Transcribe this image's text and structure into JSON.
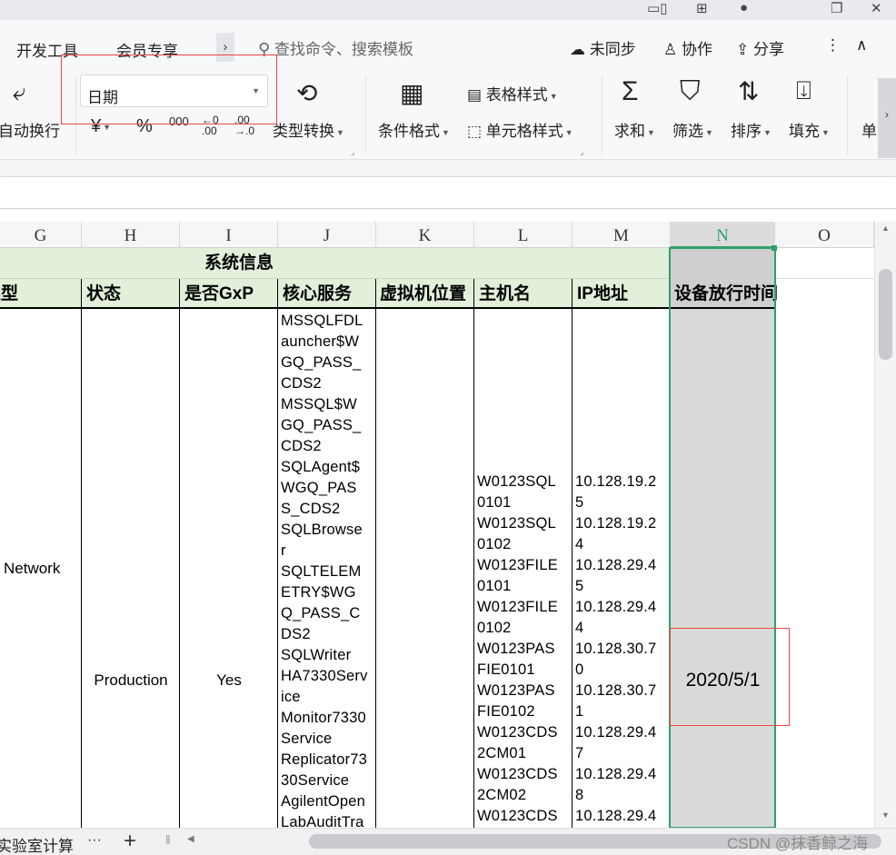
{
  "menu": {
    "items": [
      "开发工具",
      "会员专享"
    ],
    "more_chevron": "›",
    "search_placeholder": "查找命令、搜索模板",
    "sync_label": "未同步",
    "collab_label": "协作",
    "share_label": "分享",
    "more_icon": "⋮",
    "collapse_icon": "∧"
  },
  "ribbon": {
    "wrap_label": "自动换行",
    "number_format_value": "日期",
    "currency_symbol": "¥",
    "percent_symbol": "%",
    "thousands_symbol": "000",
    "decimal_inc": "←0 .00",
    "decimal_dec": ".00 →.0",
    "type_convert_label": "类型转换",
    "cond_format_label": "条件格式",
    "table_style_label": "表格样式",
    "cell_style_label": "单元格样式",
    "sum_label": "求和",
    "filter_label": "筛选",
    "sort_label": "排序",
    "fill_label": "填充",
    "cell_label_partial": "单"
  },
  "grid": {
    "columns": [
      "G",
      "H",
      "I",
      "J",
      "K",
      "L",
      "M",
      "N",
      "O"
    ],
    "selected_column": "N",
    "group_header": "系统信息",
    "headers": [
      "类型",
      "状态",
      "是否GxP",
      "核心服务",
      "虚拟机位置",
      "主机名",
      "IP地址",
      "设备放行时间"
    ],
    "row": {
      "type": "Network",
      "status": "Production",
      "gxp": "Yes",
      "core_services": [
        "MSSQLFDL",
        "auncher$W",
        "GQ_PASS_",
        "CDS2",
        "MSSQL$W",
        "GQ_PASS_",
        "CDS2",
        "SQLAgent$",
        "WGQ_PAS",
        "S_CDS2",
        "SQLBrowse",
        "r",
        "SQLTELEM",
        "ETRY$WG",
        "Q_PASS_C",
        "DS2",
        "SQLWriter",
        "HA7330Serv",
        "ice",
        "Monitor7330",
        "Service",
        "Replicator73",
        "30Service",
        "AgilentOpen",
        "LabAuditTra"
      ],
      "vm_location": "",
      "hostnames": [
        "W0123SQL",
        "0101",
        "W0123SQL",
        "0102",
        "W0123FILE",
        "0101",
        "W0123FILE",
        "0102",
        "W0123PAS",
        "FIE0101",
        "W0123PAS",
        "FIE0102",
        "W0123CDS",
        "2CM01",
        "W0123CDS",
        "2CM02",
        "W0123CDS"
      ],
      "ips": [
        "10.128.19.2",
        "5",
        "10.128.19.2",
        "4",
        "10.128.29.4",
        "5",
        "10.128.29.4",
        "4",
        "10.128.30.7",
        "0",
        "10.128.30.7",
        "1",
        "10.128.29.4",
        "7",
        "10.128.29.4",
        "8",
        "10.128.29.4"
      ],
      "release_date": "2020/5/1"
    }
  },
  "bottom": {
    "sheet_tab": "实验室计算机",
    "more_tabs": "···",
    "add_sheet": "+",
    "watermark": "CSDN @抹香鲸之海"
  },
  "colors": {
    "header_fill": "#e2efda",
    "selected_col_fill": "#d9d9d9",
    "selection_border": "#2ea06a",
    "highlight_box": "#e44444"
  }
}
